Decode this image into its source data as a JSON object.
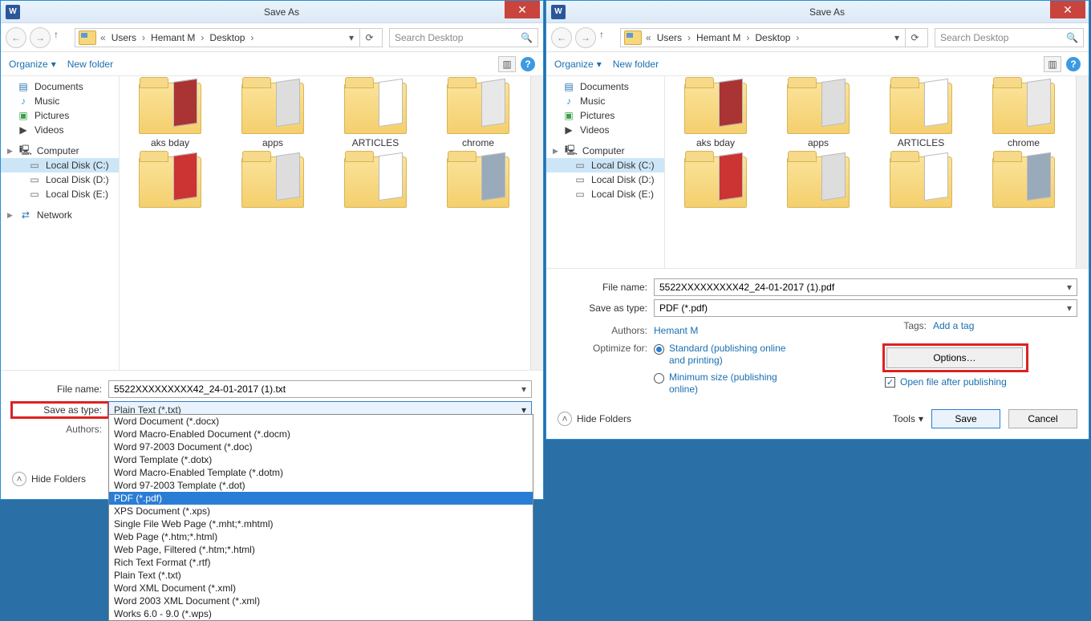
{
  "title": "Save As",
  "close_glyph": "✕",
  "nav": {
    "back": "←",
    "fwd": "→",
    "up": "↑",
    "chevrons": "«",
    "path": [
      "Users",
      "Hemant M",
      "Desktop"
    ],
    "sep": "›",
    "dd": "▾",
    "refresh": "⟳",
    "search_placeholder": "Search Desktop",
    "mag": "🔍"
  },
  "toolbar": {
    "organize": "Organize",
    "newfolder": "New folder",
    "view_icon": "▥",
    "help": "?"
  },
  "sidebar": {
    "documents": "Documents",
    "music": "Music",
    "pictures": "Pictures",
    "videos": "Videos",
    "computer": "Computer",
    "c": "Local Disk (C:)",
    "d": "Local Disk (D:)",
    "e": "Local Disk (E:)",
    "network": "Network"
  },
  "folders": {
    "r1": [
      "aks bday",
      "apps",
      "ARTICLES",
      "chrome"
    ]
  },
  "left": {
    "filename_label": "File name:",
    "filename": "5522XXXXXXXXX42_24-01-2017 (1).txt",
    "savetype_label": "Save as type:",
    "savetype": "Plain Text (*.txt)",
    "authors_label": "Authors:",
    "options": [
      "Word Document (*.docx)",
      "Word Macro-Enabled Document (*.docm)",
      "Word 97-2003 Document (*.doc)",
      "Word Template (*.dotx)",
      "Word Macro-Enabled Template (*.dotm)",
      "Word 97-2003 Template (*.dot)",
      "PDF (*.pdf)",
      "XPS Document (*.xps)",
      "Single File Web Page (*.mht;*.mhtml)",
      "Web Page (*.htm;*.html)",
      "Web Page, Filtered (*.htm;*.html)",
      "Rich Text Format (*.rtf)",
      "Plain Text (*.txt)",
      "Word XML Document (*.xml)",
      "Word 2003 XML Document (*.xml)",
      "Works 6.0 - 9.0 (*.wps)"
    ],
    "selected_index": 6
  },
  "right": {
    "filename": "5522XXXXXXXXX42_24-01-2017 (1).pdf",
    "savetype": "PDF (*.pdf)",
    "authors_label": "Authors:",
    "author": "Hemant M",
    "tags_label": "Tags:",
    "tags_add": "Add a tag",
    "optimize_label": "Optimize for:",
    "opt_standard": "Standard (publishing online and printing)",
    "opt_min": "Minimum size (publishing online)",
    "options_btn": "Options…",
    "open_after": "Open file after publishing",
    "tools": "Tools",
    "save": "Save",
    "cancel": "Cancel"
  },
  "hide_folders": "Hide Folders"
}
